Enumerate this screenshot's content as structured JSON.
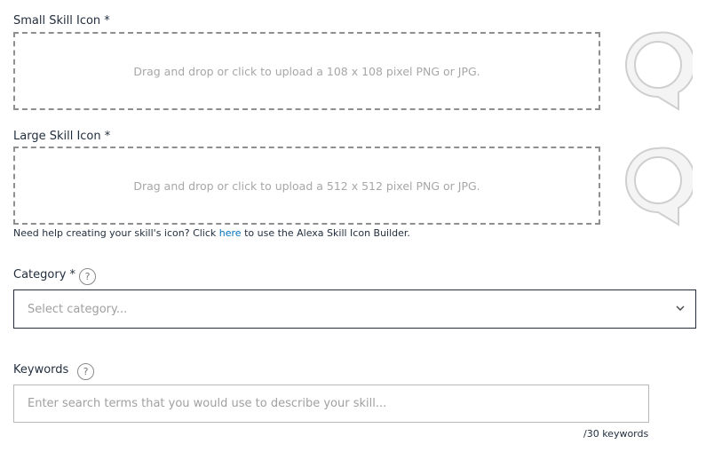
{
  "small_icon": {
    "label": "Small Skill Icon *",
    "dropzone_text": "Drag and drop or click to upload a 108 x 108 pixel PNG or JPG.",
    "preview_icon": "speech-bubble-ring-icon"
  },
  "large_icon": {
    "label": "Large Skill Icon *",
    "dropzone_text": "Drag and drop or click to upload a 512 x 512 pixel PNG or JPG.",
    "preview_icon": "speech-bubble-ring-icon"
  },
  "icon_help": {
    "before": "Need help creating your skill's icon? Click ",
    "link": "here",
    "after": " to use the Alexa Skill Icon Builder."
  },
  "category": {
    "label": "Category *",
    "help_glyph": "?",
    "placeholder": "Select category...",
    "dropdown_icon": "chevron-down-icon"
  },
  "keywords": {
    "label": "Keywords",
    "help_glyph": "?",
    "placeholder": "Enter search terms that you would use to describe your skill...",
    "counter": "/30 keywords"
  }
}
